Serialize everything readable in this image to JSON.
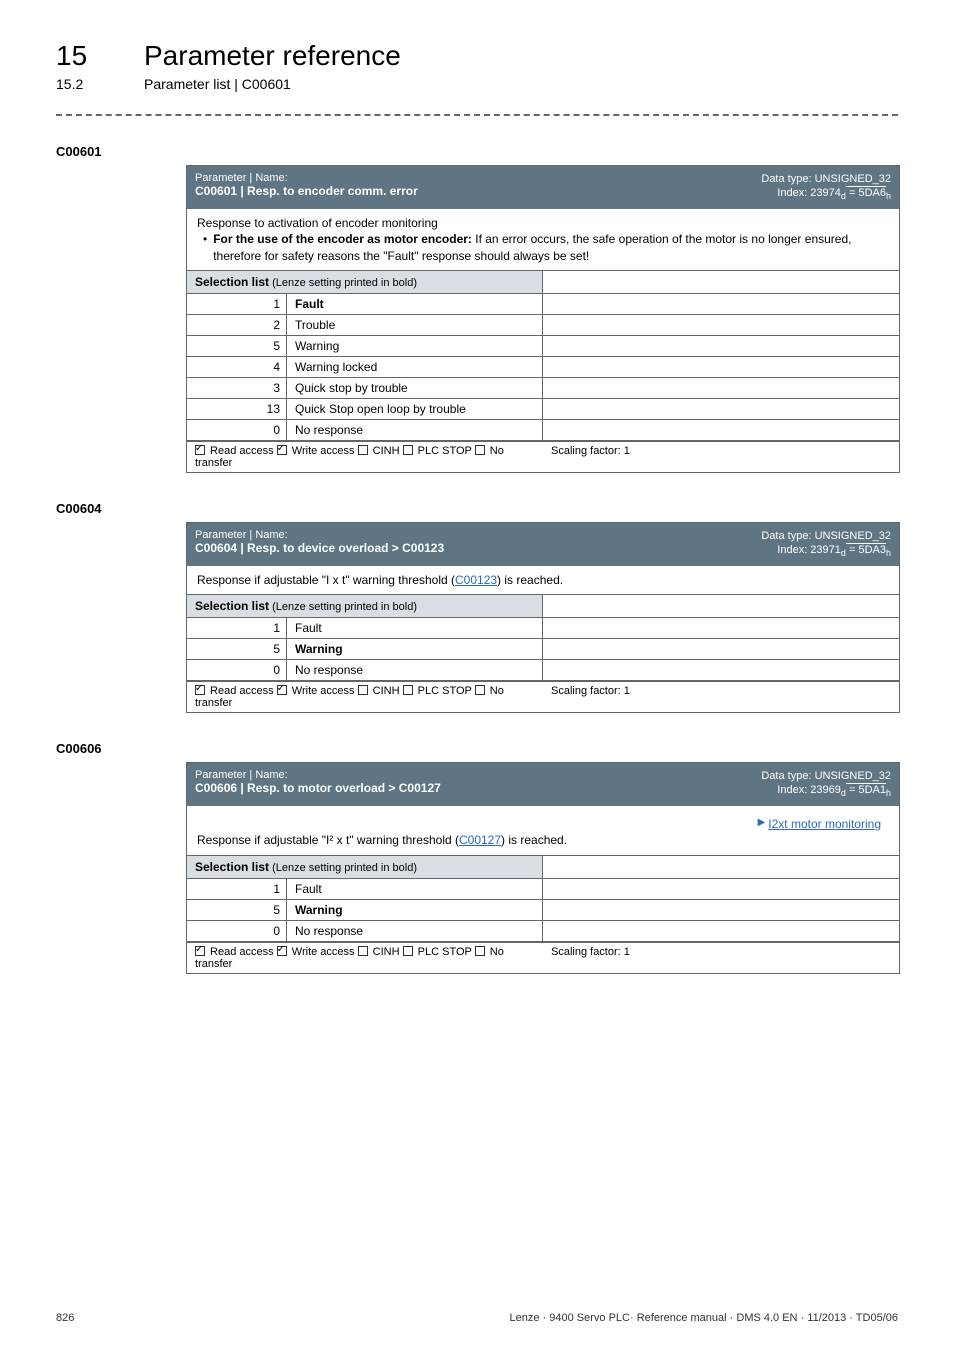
{
  "chapter": {
    "num": "15",
    "title": "Parameter reference"
  },
  "subchapter": {
    "num": "15.2",
    "title": "Parameter list | C00601"
  },
  "blocks": [
    {
      "code": "C00601",
      "header": {
        "label": "Parameter | Name:",
        "name": "C00601 | Resp. to encoder comm. error",
        "datatype": "Data type: UNSIGNED_32",
        "index_plain": "Index: 23974",
        "index_d": "d",
        "index_hex_eq": " = 5DA6",
        "index_h": "h"
      },
      "description_lines": [
        "Response to activation of encoder monitoring"
      ],
      "bullets": [
        {
          "bold": "For the use of the encoder as motor encoder:",
          "rest": " If an error occurs, the safe operation of the motor is no longer ensured, therefore for safety reasons the \"Fault\" response should always be set!"
        }
      ],
      "selection_header": {
        "bold": "Selection list",
        "small": " (Lenze setting printed in bold)"
      },
      "rows": [
        {
          "n": "1",
          "v": "Fault",
          "bold": true
        },
        {
          "n": "2",
          "v": "Trouble"
        },
        {
          "n": "5",
          "v": "Warning"
        },
        {
          "n": "4",
          "v": "Warning locked"
        },
        {
          "n": "3",
          "v": "Quick stop by trouble"
        },
        {
          "n": "13",
          "v": "Quick Stop open loop by trouble"
        },
        {
          "n": "0",
          "v": "No response"
        }
      ],
      "footer": {
        "read": {
          "checked": true,
          "label": "Read access"
        },
        "write": {
          "checked": true,
          "label": "Write access"
        },
        "cinh": {
          "checked": false,
          "label": "CINH"
        },
        "plc": {
          "checked": false,
          "label": "PLC STOP"
        },
        "notrans": {
          "checked": false,
          "label": "No transfer"
        },
        "scaling": "Scaling factor: 1"
      }
    },
    {
      "code": "C00604",
      "header": {
        "label": "Parameter | Name:",
        "name": "C00604 | Resp. to device overload > C00123",
        "datatype": "Data type: UNSIGNED_32",
        "index_plain": "Index: 23971",
        "index_d": "d",
        "index_hex_eq": " = 5DA3",
        "index_h": "h"
      },
      "description_link": {
        "pre": "Response if adjustable \"I x t\" warning threshold (",
        "link": "C00123",
        "post": ") is reached."
      },
      "selection_header": {
        "bold": "Selection list",
        "small": " (Lenze setting printed in bold)"
      },
      "rows": [
        {
          "n": "1",
          "v": "Fault"
        },
        {
          "n": "5",
          "v": "Warning",
          "bold": true
        },
        {
          "n": "0",
          "v": "No response"
        }
      ],
      "footer": {
        "read": {
          "checked": true,
          "label": "Read access"
        },
        "write": {
          "checked": true,
          "label": "Write access"
        },
        "cinh": {
          "checked": false,
          "label": "CINH"
        },
        "plc": {
          "checked": false,
          "label": "PLC STOP"
        },
        "notrans": {
          "checked": false,
          "label": "No transfer"
        },
        "scaling": "Scaling factor: 1"
      }
    },
    {
      "code": "C00606",
      "header": {
        "label": "Parameter | Name:",
        "name": "C00606 | Resp. to motor overload > C00127",
        "datatype": "Data type: UNSIGNED_32",
        "index_plain": "Index: 23969",
        "index_d": "d",
        "index_hex_eq": " = 5DA1",
        "index_h": "h"
      },
      "right_link": "I2xt motor monitoring",
      "description_link": {
        "pre": "Response if adjustable \"I² x t\" warning threshold (",
        "link": "C00127",
        "post": ") is reached."
      },
      "selection_header": {
        "bold": "Selection list",
        "small": " (Lenze setting printed in bold)"
      },
      "rows": [
        {
          "n": "1",
          "v": "Fault"
        },
        {
          "n": "5",
          "v": "Warning",
          "bold": true
        },
        {
          "n": "0",
          "v": "No response"
        }
      ],
      "footer": {
        "read": {
          "checked": true,
          "label": "Read access"
        },
        "write": {
          "checked": true,
          "label": "Write access"
        },
        "cinh": {
          "checked": false,
          "label": "CINH"
        },
        "plc": {
          "checked": false,
          "label": "PLC STOP"
        },
        "notrans": {
          "checked": false,
          "label": "No transfer"
        },
        "scaling": "Scaling factor: 1"
      }
    }
  ],
  "page_footer": {
    "page_num": "826",
    "ref": "Lenze · 9400 Servo PLC· Reference manual · DMS 4.0 EN · 11/2013 · TD05/06"
  }
}
